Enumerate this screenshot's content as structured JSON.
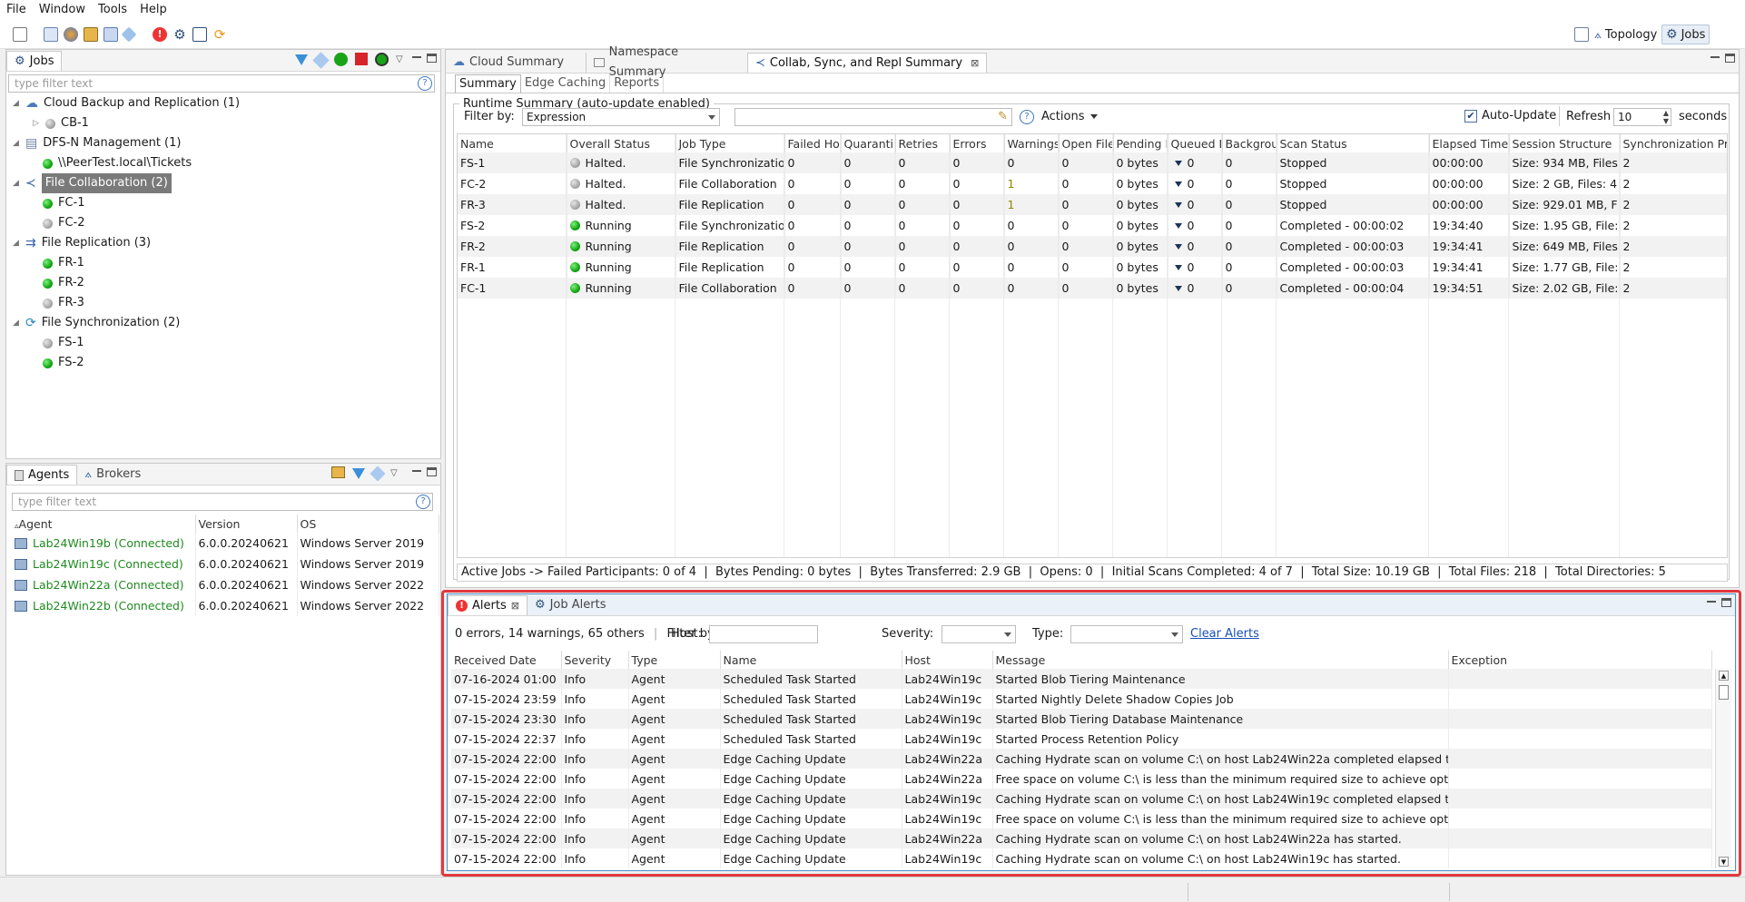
{
  "menu": [
    "File",
    "Window",
    "Tools",
    "Help"
  ],
  "perspectives": [
    {
      "label": "Topology",
      "icon": "topology-icon",
      "active": false
    },
    {
      "label": "Jobs",
      "icon": "gear-icon",
      "active": true
    }
  ],
  "jobs_view": {
    "tab": "Jobs",
    "filter_placeholder": "type filter text",
    "tree": [
      {
        "type": "category",
        "label": "Cloud Backup and Replication (1)",
        "icon": "cloud-icon",
        "expanded": true
      },
      {
        "type": "job",
        "label": "CB-1",
        "status": "gray",
        "collapsed": true
      },
      {
        "type": "category",
        "label": "DFS-N Management (1)",
        "icon": "dfsn-icon",
        "expanded": true
      },
      {
        "type": "job",
        "label": "\\\\PeerTest.local\\Tickets",
        "status": "green"
      },
      {
        "type": "category",
        "label": "File Collaboration (2)",
        "icon": "collab-icon",
        "expanded": true,
        "selected": true
      },
      {
        "type": "job",
        "label": "FC-1",
        "status": "green"
      },
      {
        "type": "job",
        "label": "FC-2",
        "status": "gray"
      },
      {
        "type": "category",
        "label": "File Replication (3)",
        "icon": "replication-icon",
        "expanded": true
      },
      {
        "type": "job",
        "label": "FR-1",
        "status": "green"
      },
      {
        "type": "job",
        "label": "FR-2",
        "status": "green"
      },
      {
        "type": "job",
        "label": "FR-3",
        "status": "gray"
      },
      {
        "type": "category",
        "label": "File Synchronization (2)",
        "icon": "sync-icon",
        "expanded": true
      },
      {
        "type": "job",
        "label": "FS-1",
        "status": "gray"
      },
      {
        "type": "job",
        "label": "FS-2",
        "status": "green"
      }
    ]
  },
  "agents_view": {
    "tabs": [
      "Agents",
      "Brokers"
    ],
    "filter_placeholder": "type filter text",
    "columns": [
      "Agent",
      "Version",
      "OS"
    ],
    "rows": [
      [
        "Lab24Win19b (Connected)",
        "6.0.0.20240621",
        "Windows Server 2019"
      ],
      [
        "Lab24Win19c (Connected)",
        "6.0.0.20240621",
        "Windows Server 2019"
      ],
      [
        "Lab24Win22a (Connected)",
        "6.0.0.20240621",
        "Windows Server 2022"
      ],
      [
        "Lab24Win22b (Connected)",
        "6.0.0.20240621",
        "Windows Server 2022"
      ]
    ]
  },
  "editor": {
    "tabs": [
      "Cloud Summary",
      "Namespace Summary",
      "Collab, Sync, and Repl Summary"
    ],
    "subtabs": [
      "Summary",
      "Edge Caching",
      "Reports"
    ],
    "runtime_title": "Runtime Summary (auto-update enabled)",
    "filter_by_label": "Filter by:",
    "filter_by_value": "Expression",
    "actions_label": "Actions",
    "auto_update_label": "Auto-Update",
    "refresh_label": "Refresh",
    "refresh_value": "10",
    "seconds_label": "seconds",
    "columns": [
      "Name",
      "Overall Status",
      "Job Type",
      "Failed Ho",
      "Quarantin",
      "Retries",
      "Errors",
      "Warnings",
      "Open File",
      "Pending B",
      "Queued I",
      "Backgrou",
      "Scan Status",
      "Elapsed Time",
      "Session Structure",
      "Synchronization Pri"
    ],
    "rows": [
      {
        "name": "FS-1",
        "status": "Halted.",
        "dot": "gray",
        "type": "File Synchronizatio",
        "failed": "0",
        "quar": "0",
        "retries": "0",
        "errors": "0",
        "warnings": "0",
        "open": "0",
        "pending": "0 bytes",
        "queued": "0",
        "bg": "0",
        "scan": "Stopped",
        "elapsed": "00:00:00",
        "session": "Size: 934 MB, Files",
        "prio": "2"
      },
      {
        "name": "FC-2",
        "status": "Halted.",
        "dot": "gray",
        "type": "File Collaboration",
        "failed": "0",
        "quar": "0",
        "retries": "0",
        "errors": "0",
        "warnings": "1",
        "open": "0",
        "pending": "0 bytes",
        "queued": "0",
        "bg": "0",
        "scan": "Stopped",
        "elapsed": "00:00:00",
        "session": "Size: 2 GB, Files: 4",
        "prio": "2"
      },
      {
        "name": "FR-3",
        "status": "Halted.",
        "dot": "gray",
        "type": "File Replication",
        "failed": "0",
        "quar": "0",
        "retries": "0",
        "errors": "0",
        "warnings": "1",
        "open": "0",
        "pending": "0 bytes",
        "queued": "0",
        "bg": "0",
        "scan": "Stopped",
        "elapsed": "00:00:00",
        "session": "Size: 929.01 MB, F",
        "prio": "2"
      },
      {
        "name": "FS-2",
        "status": "Running",
        "dot": "green",
        "type": "File Synchronizatio",
        "failed": "0",
        "quar": "0",
        "retries": "0",
        "errors": "0",
        "warnings": "0",
        "open": "0",
        "pending": "0 bytes",
        "queued": "0",
        "bg": "0",
        "scan": "Completed - 00:00:02",
        "elapsed": "19:34:40",
        "session": "Size: 1.95 GB, File:",
        "prio": "2"
      },
      {
        "name": "FR-2",
        "status": "Running",
        "dot": "green",
        "type": "File Replication",
        "failed": "0",
        "quar": "0",
        "retries": "0",
        "errors": "0",
        "warnings": "0",
        "open": "0",
        "pending": "0 bytes",
        "queued": "0",
        "bg": "0",
        "scan": "Completed - 00:00:03",
        "elapsed": "19:34:41",
        "session": "Size: 649 MB, Files",
        "prio": "2"
      },
      {
        "name": "FR-1",
        "status": "Running",
        "dot": "green",
        "type": "File Replication",
        "failed": "0",
        "quar": "0",
        "retries": "0",
        "errors": "0",
        "warnings": "0",
        "open": "0",
        "pending": "0 bytes",
        "queued": "0",
        "bg": "0",
        "scan": "Completed - 00:00:03",
        "elapsed": "19:34:41",
        "session": "Size: 1.77 GB, File:",
        "prio": "2"
      },
      {
        "name": "FC-1",
        "status": "Running",
        "dot": "green",
        "type": "File Collaboration",
        "failed": "0",
        "quar": "0",
        "retries": "0",
        "errors": "0",
        "warnings": "0",
        "open": "0",
        "pending": "0 bytes",
        "queued": "0",
        "bg": "0",
        "scan": "Completed - 00:00:04",
        "elapsed": "19:34:51",
        "session": "Size: 2.02 GB, File:",
        "prio": "2"
      }
    ],
    "status_bar": "Active Jobs -> Failed Participants: 0 of 4  |  Bytes Pending: 0 bytes  |  Bytes Transferred: 2.9 GB  |  Opens: 0  |  Initial Scans Completed: 4 of 7  |  Total Size: 10.19 GB  |  Total Files: 218  |  Total Directories: 5"
  },
  "alerts_view": {
    "tabs": [
      "Alerts",
      "Job Alerts"
    ],
    "summary": "0 errors, 14 warnings, 65 others",
    "filter_by_label": "Filter by :",
    "host_label": "Host:",
    "severity_label": "Severity:",
    "type_label": "Type:",
    "clear_label": "Clear Alerts",
    "columns": [
      "Received Date",
      "Severity",
      "Type",
      "Name",
      "Host",
      "Message",
      "Exception"
    ],
    "rows": [
      [
        "07-16-2024 01:00",
        "Info",
        "Agent",
        "Scheduled Task Started",
        "Lab24Win19c",
        "Started Blob Tiering Maintenance",
        ""
      ],
      [
        "07-15-2024 23:59",
        "Info",
        "Agent",
        "Scheduled Task Started",
        "Lab24Win19c",
        "Started Nightly Delete Shadow Copies Job",
        ""
      ],
      [
        "07-15-2024 23:30",
        "Info",
        "Agent",
        "Scheduled Task Started",
        "Lab24Win19c",
        "Started Blob Tiering Database Maintenance",
        ""
      ],
      [
        "07-15-2024 22:37",
        "Info",
        "Agent",
        "Scheduled Task Started",
        "Lab24Win19c",
        "Started Process Retention Policy",
        ""
      ],
      [
        "07-15-2024 22:00",
        "Info",
        "Agent",
        "Edge Caching Update",
        "Lab24Win22a",
        "Caching Hydrate scan on volume C:\\ on host Lab24Win22a completed elapsed tim",
        ""
      ],
      [
        "07-15-2024 22:00",
        "Info",
        "Agent",
        "Edge Caching Update",
        "Lab24Win22a",
        "Free space on volume C:\\ is less than the minimum required size to achieve optin",
        ""
      ],
      [
        "07-15-2024 22:00",
        "Info",
        "Agent",
        "Edge Caching Update",
        "Lab24Win19c",
        "Caching Hydrate scan on volume C:\\ on host Lab24Win19c completed elapsed tim",
        ""
      ],
      [
        "07-15-2024 22:00",
        "Info",
        "Agent",
        "Edge Caching Update",
        "Lab24Win19c",
        "Free space on volume C:\\ is less than the minimum required size to achieve optin",
        ""
      ],
      [
        "07-15-2024 22:00",
        "Info",
        "Agent",
        "Edge Caching Update",
        "Lab24Win22a",
        "Caching Hydrate scan on volume C:\\ on host Lab24Win22a has started.",
        ""
      ],
      [
        "07-15-2024 22:00",
        "Info",
        "Agent",
        "Edge Caching Update",
        "Lab24Win19c",
        "Caching Hydrate scan on volume C:\\ on host Lab24Win19c has started.",
        ""
      ]
    ]
  },
  "colors": {
    "highlight_border": "#e0393e",
    "alerts_active_border": "#4a90c8",
    "connected_text": "#1f8a1f",
    "link": "#1a4fb6"
  }
}
